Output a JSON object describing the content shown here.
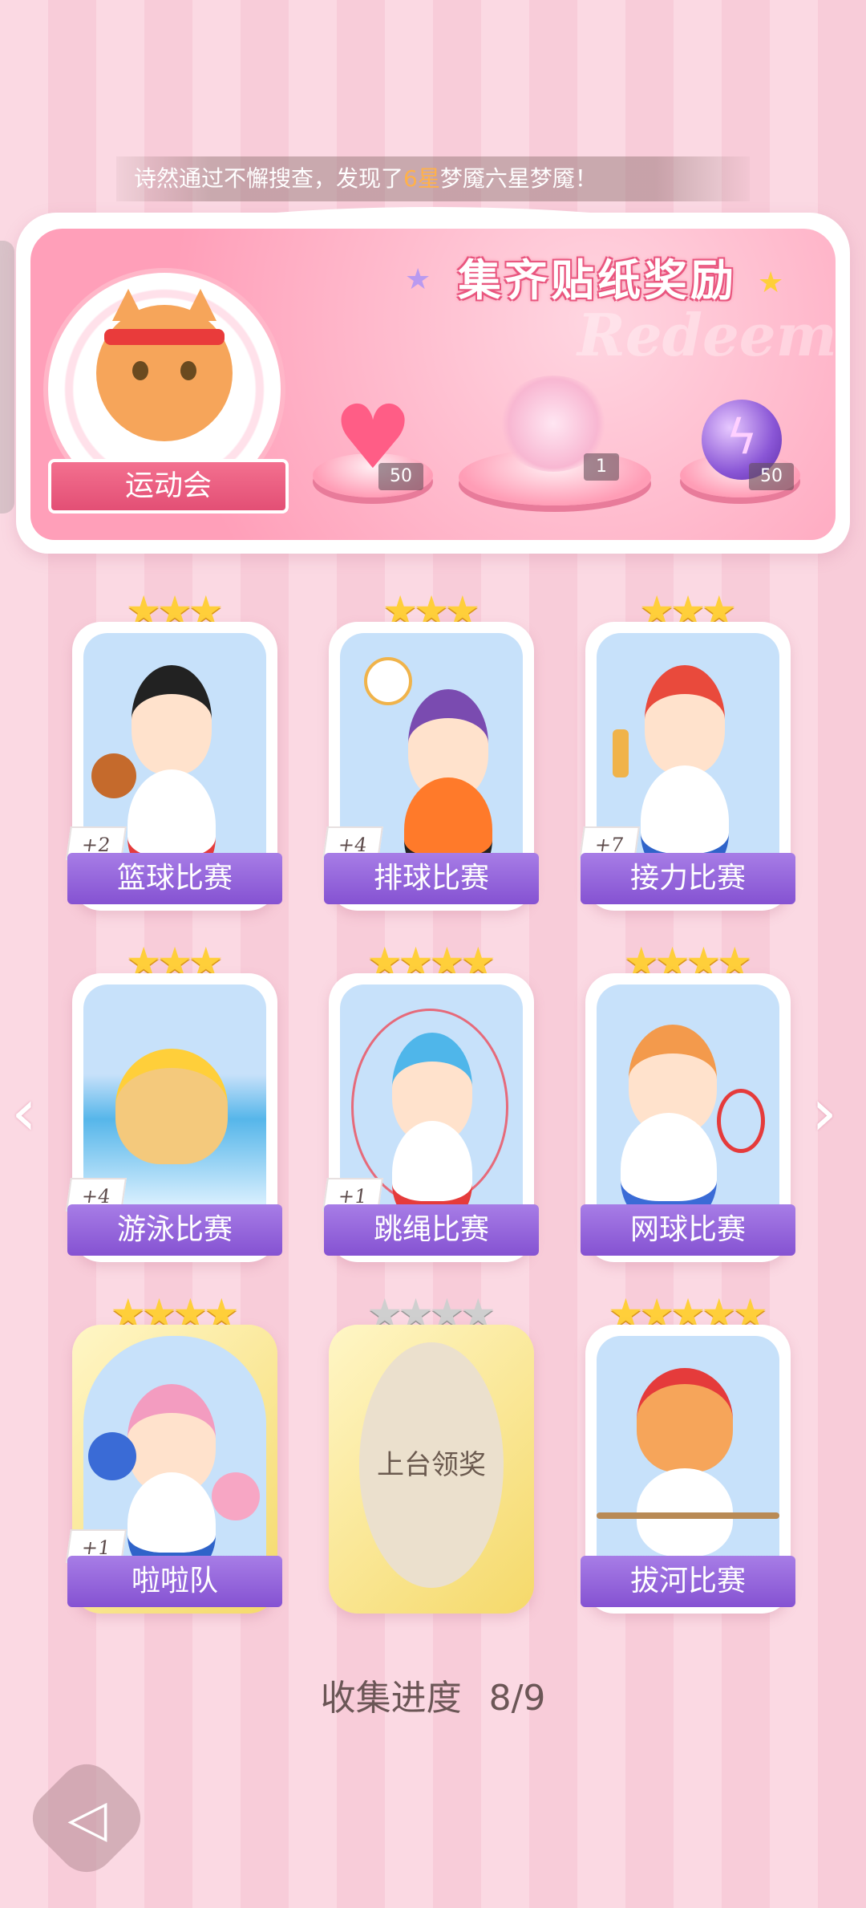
{
  "banner": {
    "text_before": "诗然通过不懈搜查，发现了",
    "highlight": "6星",
    "text_after": "梦魇六星梦魇！",
    "highlight_color": "#ffb14a"
  },
  "reward_panel": {
    "title": "集齐贴纸奖励",
    "background_word": "Redeem",
    "event_name": "运动会",
    "rewards": [
      {
        "name": "heart-gem",
        "count": "50"
      },
      {
        "name": "bouquet",
        "count": "1"
      },
      {
        "name": "lightning-orb",
        "count": "50"
      }
    ]
  },
  "cards": [
    {
      "label": "篮球比赛",
      "stars": 3,
      "bonus": "+2",
      "collected": true
    },
    {
      "label": "排球比赛",
      "stars": 3,
      "bonus": "+4",
      "collected": true
    },
    {
      "label": "接力比赛",
      "stars": 3,
      "bonus": "+7",
      "collected": true
    },
    {
      "label": "游泳比赛",
      "stars": 3,
      "bonus": "+4",
      "collected": true
    },
    {
      "label": "跳绳比赛",
      "stars": 4,
      "bonus": "+1",
      "collected": true
    },
    {
      "label": "网球比赛",
      "stars": 4,
      "bonus": "",
      "collected": true
    },
    {
      "label": "啦啦队",
      "stars": 4,
      "bonus": "+1",
      "collected": true
    },
    {
      "label": "上台领奖",
      "stars": 4,
      "bonus": "",
      "collected": false
    },
    {
      "label": "拔河比赛",
      "stars": 5,
      "bonus": "",
      "collected": true
    }
  ],
  "progress": {
    "label": "收集进度",
    "value": "8/9"
  },
  "icons": {
    "left_arrow": "chevron-left-icon",
    "right_arrow": "chevron-right-icon",
    "back": "back-icon"
  },
  "colors": {
    "star_gold": "#ffcf3a",
    "label_purple": "#8552d2",
    "panel_pink": "#ff9fb9"
  }
}
